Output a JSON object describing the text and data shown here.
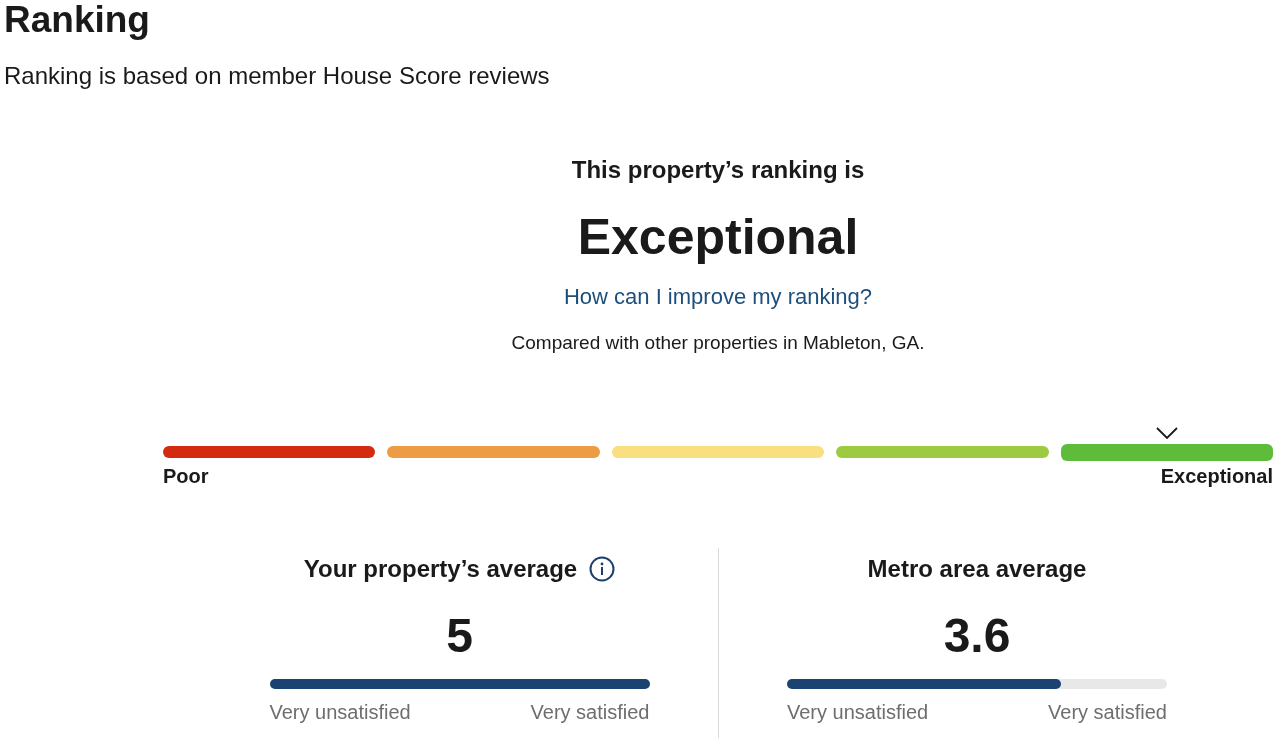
{
  "header": {
    "title": "Ranking",
    "subtitle": "Ranking is based on member House Score reviews"
  },
  "summary": {
    "intro": "This property’s ranking is",
    "ranking": "Exceptional",
    "link": "How can I improve my ranking?",
    "comparison": "Compared with other properties in Mableton, GA."
  },
  "scale": {
    "segments": [
      {
        "color": "#d32a10",
        "selected": false
      },
      {
        "color": "#ed9b45",
        "selected": false
      },
      {
        "color": "#f9df80",
        "selected": false
      },
      {
        "color": "#9dca40",
        "selected": false
      },
      {
        "color": "#5fbb3a",
        "selected": true
      }
    ],
    "low_label": "Poor",
    "high_label": "Exceptional"
  },
  "panels": [
    {
      "title": "Your property’s average",
      "info": true,
      "value": "5",
      "level": 1.0,
      "low_label": "Very unsatisfied",
      "high_label": "Very satisfied"
    },
    {
      "title": "Metro area average",
      "info": false,
      "value": "3.6",
      "level": 0.72,
      "low_label": "Very unsatisfied",
      "high_label": "Very satisfied"
    }
  ]
}
